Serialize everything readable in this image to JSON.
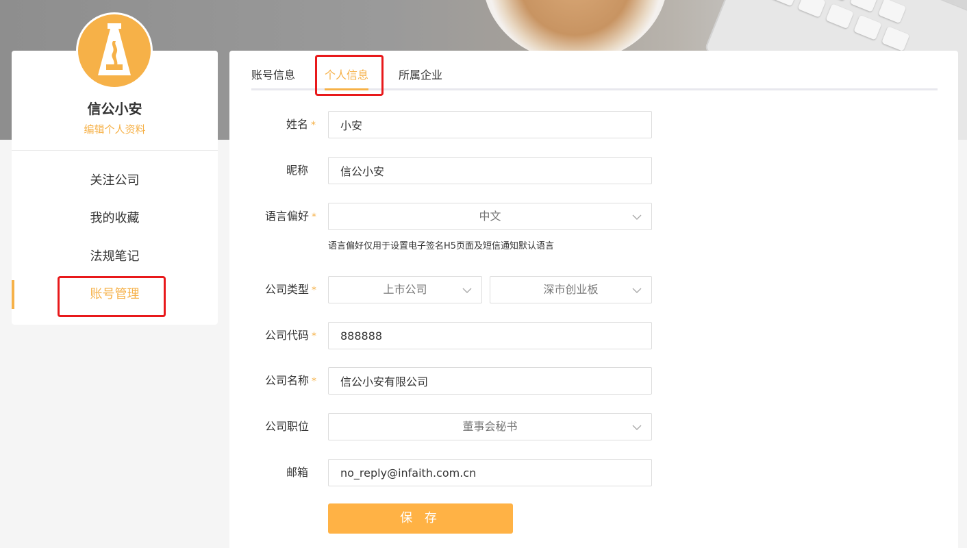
{
  "profile": {
    "username": "信公小安",
    "edit_link": "编辑个人资料"
  },
  "sidebar": {
    "items": [
      {
        "label": "关注公司"
      },
      {
        "label": "我的收藏"
      },
      {
        "label": "法规笔记"
      },
      {
        "label": "账号管理",
        "active": true
      }
    ]
  },
  "tabs": [
    {
      "label": "账号信息"
    },
    {
      "label": "个人信息",
      "active": true
    },
    {
      "label": "所属企业"
    }
  ],
  "form": {
    "name": {
      "label": "姓名",
      "value": "小安",
      "required": "*"
    },
    "nickname": {
      "label": "昵称",
      "value": "信公小安"
    },
    "language": {
      "label": "语言偏好",
      "value": "中文",
      "required": "*",
      "hint": "语言偏好仅用于设置电子签名H5页面及短信通知默认语言"
    },
    "company_type": {
      "label": "公司类型",
      "value1": "上市公司",
      "value2": "深市创业板",
      "required": "*"
    },
    "company_code": {
      "label": "公司代码",
      "value": "888888",
      "required": "*"
    },
    "company_name": {
      "label": "公司名称",
      "value": "信公小安有限公司",
      "required": "*"
    },
    "position": {
      "label": "公司职位",
      "value": "董事会秘书"
    },
    "email": {
      "label": "邮箱",
      "value": "no_reply@infaith.com.cn"
    },
    "save_label": "保 存"
  },
  "colors": {
    "accent": "#f6b148",
    "highlight_box": "#e8191b"
  },
  "icons": {
    "avatar": "lighthouse-logo-icon",
    "dropdown": "chevron-down-icon"
  }
}
